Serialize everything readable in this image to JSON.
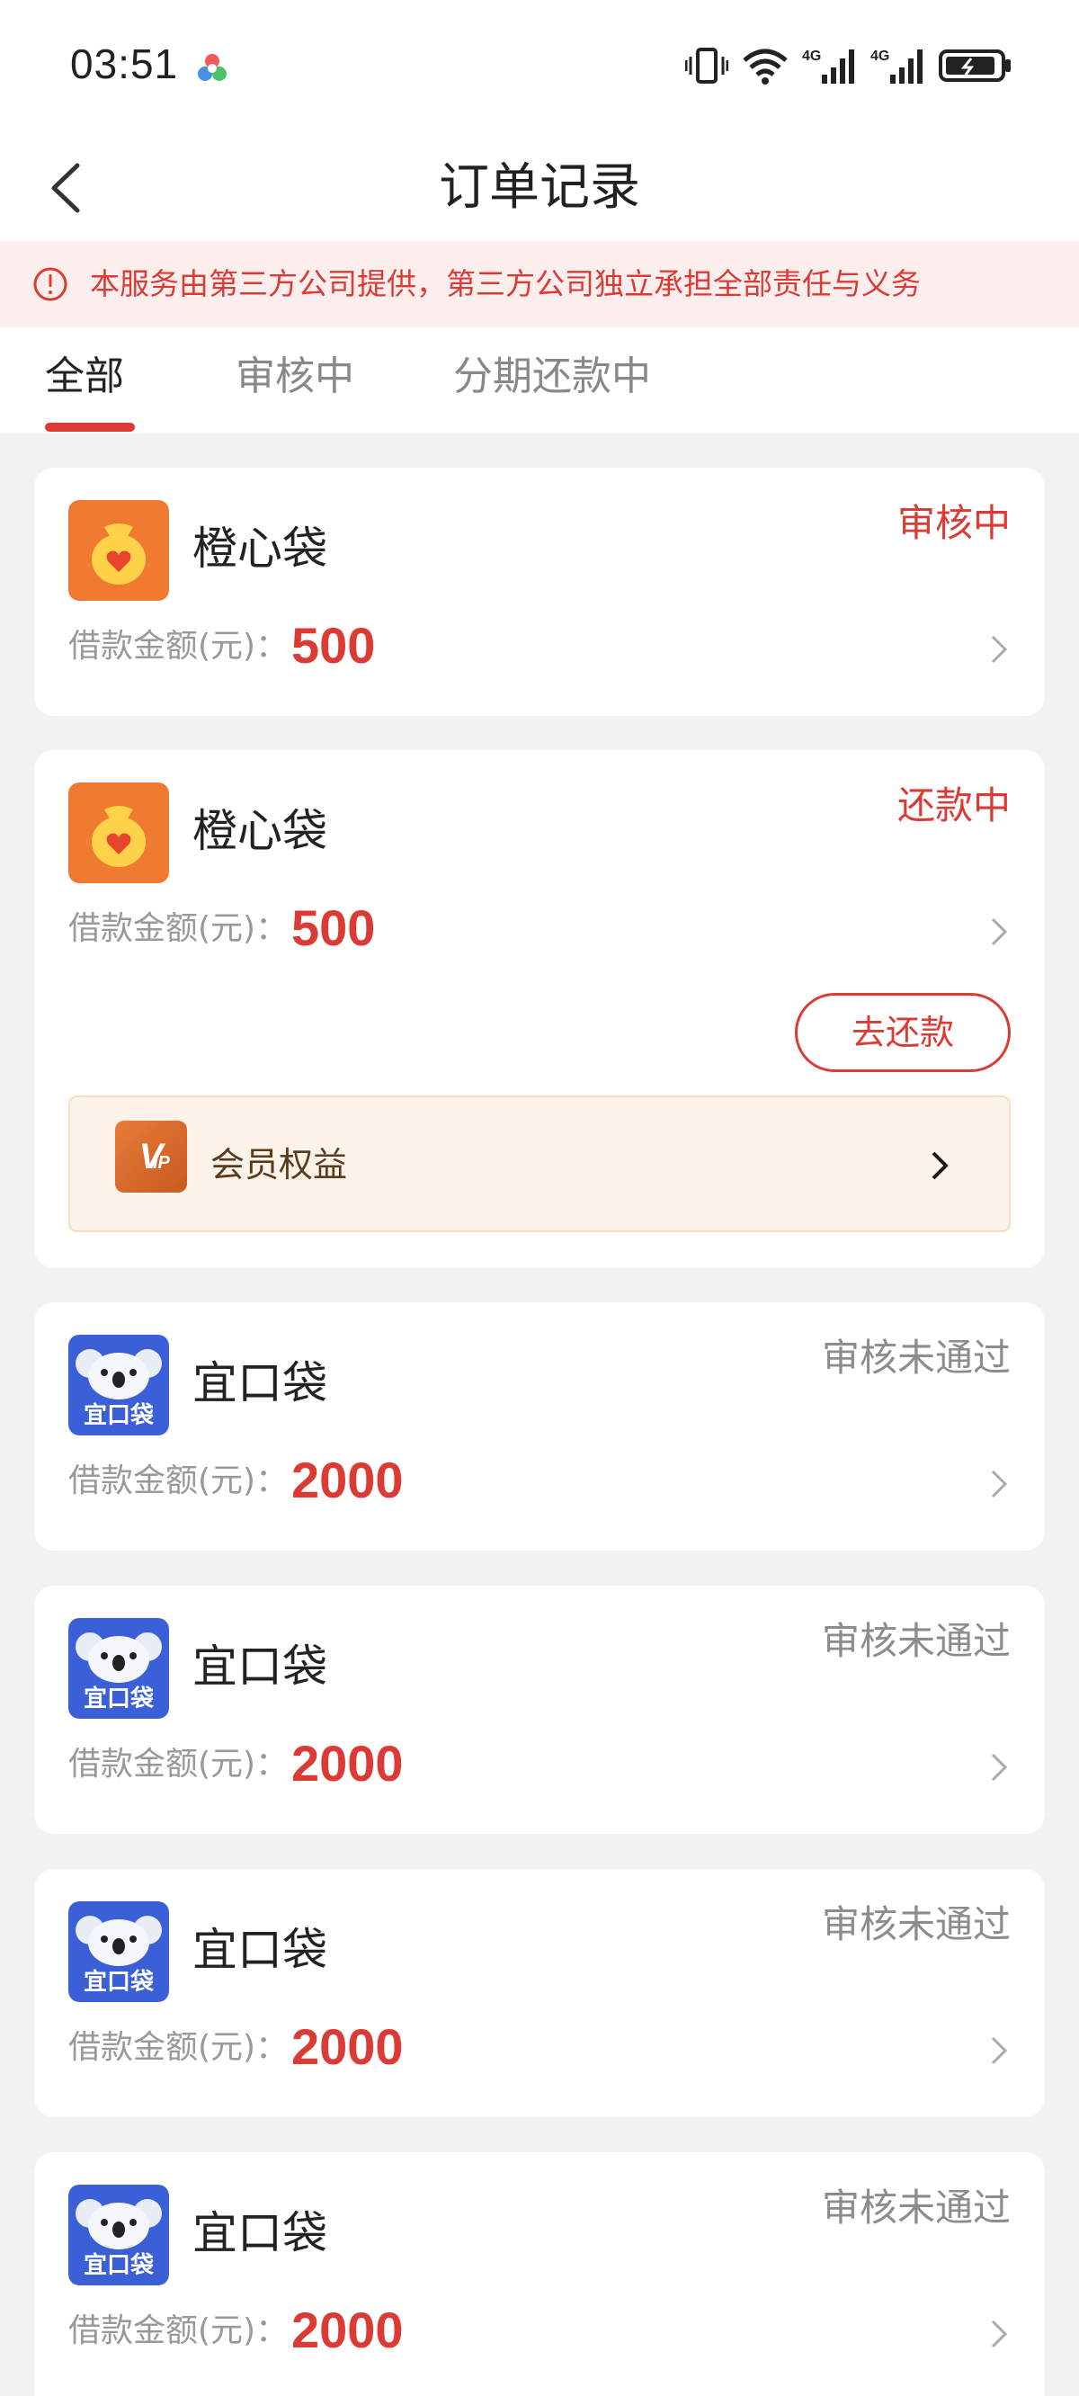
{
  "status_bar": {
    "time": "03:51"
  },
  "nav": {
    "title": "订单记录"
  },
  "notice": {
    "text": "本服务由第三方公司提供，第三方公司独立承担全部责任与义务"
  },
  "tabs": [
    {
      "label": "全部",
      "active": true
    },
    {
      "label": "审核中",
      "active": false
    },
    {
      "label": "分期还款中",
      "active": false
    }
  ],
  "colors": {
    "accent": "#dc3b35",
    "orange_logo": "#f07a30",
    "blue_logo": "#3a5fd6"
  },
  "amount_label": "借款金额(元)：",
  "orders": [
    {
      "name": "橙心袋",
      "logo": "money-bag-heart-icon",
      "status": "审核中",
      "status_color": "red",
      "amount": "500"
    },
    {
      "name": "橙心袋",
      "logo": "money-bag-heart-icon",
      "status": "还款中",
      "status_color": "red",
      "amount": "500",
      "action": "去还款",
      "vip_label": "会员权益"
    },
    {
      "name": "宜口袋",
      "logo": "koala-icon",
      "logo_text": "宜口袋",
      "status": "审核未通过",
      "status_color": "gray",
      "amount": "2000"
    },
    {
      "name": "宜口袋",
      "logo": "koala-icon",
      "logo_text": "宜口袋",
      "status": "审核未通过",
      "status_color": "gray",
      "amount": "2000"
    },
    {
      "name": "宜口袋",
      "logo": "koala-icon",
      "logo_text": "宜口袋",
      "status": "审核未通过",
      "status_color": "gray",
      "amount": "2000"
    },
    {
      "name": "宜口袋",
      "logo": "koala-icon",
      "logo_text": "宜口袋",
      "status": "审核未通过",
      "status_color": "gray",
      "amount": "2000"
    }
  ]
}
